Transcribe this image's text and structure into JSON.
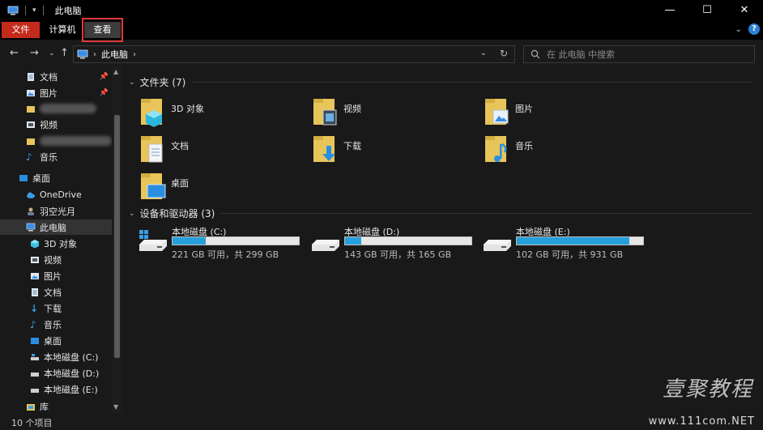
{
  "window": {
    "title": "此电脑"
  },
  "ribbon": {
    "tabs": [
      "文件",
      "计算机",
      "查看"
    ]
  },
  "address": {
    "location": "此电脑"
  },
  "search": {
    "placeholder": "在 此电脑 中搜索"
  },
  "nav_pane": {
    "quick_access": [
      "文档",
      "图片",
      "视频",
      "音乐"
    ],
    "desktop": "桌面",
    "onedrive": "OneDrive",
    "user": "羽空光月",
    "this_pc": "此电脑",
    "pc_children": [
      "3D 对象",
      "视频",
      "图片",
      "文档",
      "下载",
      "音乐",
      "桌面",
      "本地磁盘 (C:)",
      "本地磁盘 (D:)",
      "本地磁盘 (E:)"
    ],
    "libraries": "库"
  },
  "folders_group": {
    "header": "文件夹 (7)",
    "items": [
      "3D 对象",
      "视频",
      "图片",
      "文档",
      "下载",
      "音乐",
      "桌面"
    ]
  },
  "drives_group": {
    "header": "设备和驱动器 (3)",
    "items": [
      {
        "name": "本地磁盘 (C:)",
        "free": "221 GB 可用，共 299 GB",
        "used_fraction": 0.26
      },
      {
        "name": "本地磁盘 (D:)",
        "free": "143 GB 可用，共 165 GB",
        "used_fraction": 0.13
      },
      {
        "name": "本地磁盘 (E:)",
        "free": "102 GB 可用，共 931 GB",
        "used_fraction": 0.89
      }
    ]
  },
  "status": {
    "item_count": "10 个项目"
  },
  "watermark": {
    "brand": "壹聚教程",
    "url": "www.111com.NET"
  },
  "colors": {
    "accent": "#26a0da",
    "file_tab": "#c42b1c",
    "highlight_outline": "#e03a3a"
  }
}
